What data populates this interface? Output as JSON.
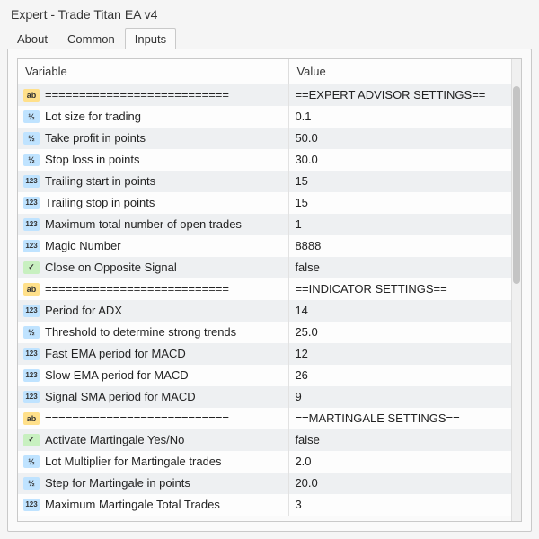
{
  "window": {
    "title": "Expert - Trade Titan EA v4"
  },
  "tabs": [
    "About",
    "Common",
    "Inputs"
  ],
  "columns": {
    "variable": "Variable",
    "value": "Value"
  },
  "type_glyph": {
    "ab": "ab",
    "va": "½",
    "123": "123",
    "bool": "✓"
  },
  "rows": [
    {
      "type": "ab",
      "name": "===========================",
      "value": "==EXPERT ADVISOR SETTINGS=="
    },
    {
      "type": "va",
      "name": "Lot size for trading",
      "value": "0.1"
    },
    {
      "type": "va",
      "name": "Take profit in points",
      "value": "50.0"
    },
    {
      "type": "va",
      "name": "Stop loss in points",
      "value": "30.0"
    },
    {
      "type": "123",
      "name": "Trailing start in points",
      "value": "15"
    },
    {
      "type": "123",
      "name": "Trailing stop in points",
      "value": "15"
    },
    {
      "type": "123",
      "name": "Maximum total number of open trades",
      "value": "1"
    },
    {
      "type": "123",
      "name": "Magic Number",
      "value": "8888"
    },
    {
      "type": "bool",
      "name": "Close on Opposite Signal",
      "value": "false"
    },
    {
      "type": "ab",
      "name": "===========================",
      "value": "==INDICATOR SETTINGS=="
    },
    {
      "type": "123",
      "name": "Period for ADX",
      "value": "14"
    },
    {
      "type": "va",
      "name": "Threshold to determine strong trends",
      "value": "25.0"
    },
    {
      "type": "123",
      "name": "Fast EMA period for MACD",
      "value": "12"
    },
    {
      "type": "123",
      "name": "Slow EMA period for MACD",
      "value": "26"
    },
    {
      "type": "123",
      "name": "Signal SMA period for MACD",
      "value": "9"
    },
    {
      "type": "ab",
      "name": "===========================",
      "value": "==MARTINGALE SETTINGS=="
    },
    {
      "type": "bool",
      "name": "Activate Martingale Yes/No",
      "value": "false"
    },
    {
      "type": "va",
      "name": "Lot Multiplier for Martingale trades",
      "value": "2.0"
    },
    {
      "type": "va",
      "name": "Step for Martingale in points",
      "value": "20.0"
    },
    {
      "type": "123",
      "name": "Maximum Martingale Total Trades",
      "value": "3"
    }
  ]
}
